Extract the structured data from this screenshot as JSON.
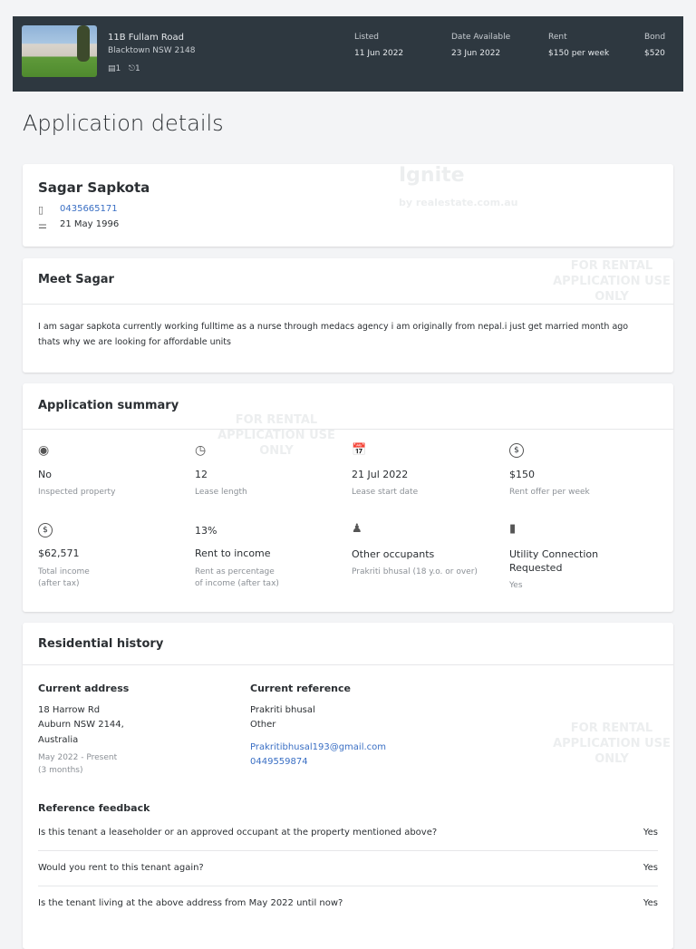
{
  "listing": {
    "address_line1": "11B Fullam Road",
    "address_line2": "Blacktown NSW 2148",
    "bedrooms": "1",
    "bathrooms": "1",
    "listed_label": "Listed",
    "listed": "11 Jun 2022",
    "available_label": "Date Available",
    "available": "23 Jun 2022",
    "rent_label": "Rent",
    "rent": "$150 per week",
    "bond_label": "Bond",
    "bond": "$520"
  },
  "page_title": "Application details",
  "applicant": {
    "name": "Sagar Sapkota",
    "phone": "0435665171",
    "dob": "21 May 1996"
  },
  "about": {
    "title": "Meet Sagar",
    "text": "I am sagar sapkota currently working fulltime as a nurse through medacs agency i am originally from nepal.i just get married month ago thats why we are looking for affordable units"
  },
  "summary": {
    "title": "Application summary",
    "items": [
      {
        "icon": "eye-icon",
        "value": "No",
        "label": "Inspected property"
      },
      {
        "icon": "clock-icon",
        "value": "12",
        "label": "Lease length"
      },
      {
        "icon": "calendar-icon",
        "value": "21 Jul 2022",
        "label": "Lease start date"
      },
      {
        "icon": "dollar-icon",
        "value": "$150",
        "label": "Rent offer per week"
      },
      {
        "icon": "dollar-icon",
        "value": "$62,571",
        "label": "Total income",
        "label2": "(after tax)"
      },
      {
        "value": "13%",
        "title": "Rent to income",
        "label": "Rent as percentage",
        "label2": "of income (after tax)"
      },
      {
        "icon": "person-icon",
        "title": "Other occupants",
        "label": "Prakriti bhusal (18 y.o. or over)"
      },
      {
        "icon": "plug-icon",
        "title": "Utility Connection",
        "title2": "Requested",
        "label": "Yes"
      }
    ]
  },
  "history": {
    "title": "Residential history",
    "address_title": "Current address",
    "address": [
      "18 Harrow Rd",
      "Auburn NSW 2144,",
      "Australia"
    ],
    "period": "May 2022 - Present",
    "duration": "(3 months)",
    "reference_title": "Current reference",
    "ref_name": "Prakriti bhusal",
    "ref_relation": "Other",
    "ref_email": "Prakritibhusal193@gmail.com",
    "ref_phone": "0449559874",
    "feedback_title": "Reference feedback",
    "feedback": [
      {
        "q": "Is this tenant a leaseholder or an approved occupant at the property mentioned above?",
        "a": "Yes"
      },
      {
        "q": "Would you rent to this tenant again?",
        "a": "Yes"
      },
      {
        "q": "Is the tenant living at the above address from May 2022 until now?",
        "a": "Yes"
      }
    ]
  },
  "watermark": {
    "brand": "Ignite",
    "sub": "by realestate.com.au",
    "notice": "FOR RENTAL APPLICATION USE ONLY"
  }
}
